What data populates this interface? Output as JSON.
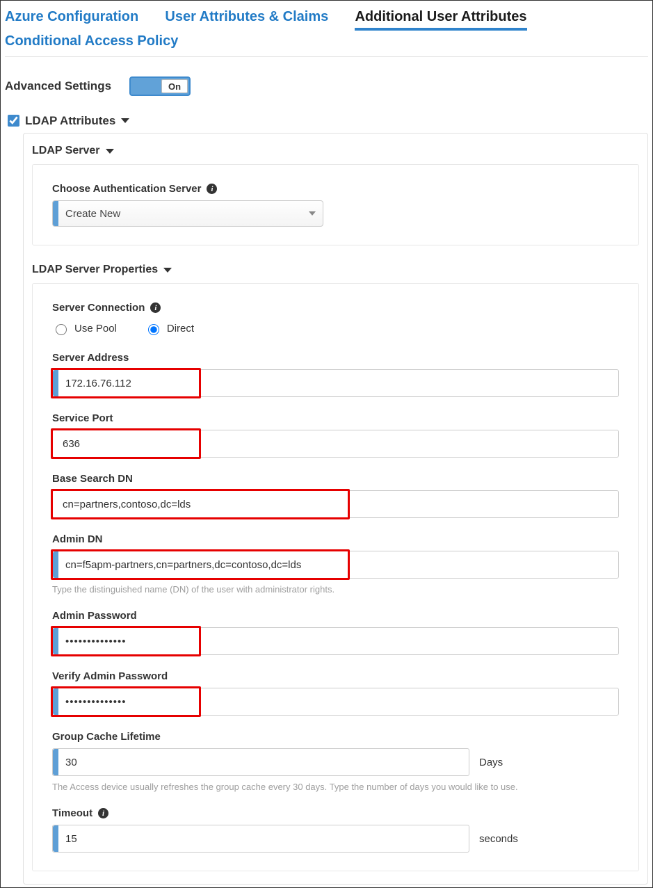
{
  "tabs": {
    "azure": "Azure Configuration",
    "claims": "User Attributes & Claims",
    "additional": "Additional User Attributes",
    "policy": "Conditional Access Policy"
  },
  "advanced": {
    "label": "Advanced Settings",
    "state": "On"
  },
  "ldap_attributes": {
    "title": "LDAP Attributes"
  },
  "ldap_server": {
    "title": "LDAP Server",
    "choose_label": "Choose Authentication Server",
    "choose_value": "Create New"
  },
  "ldap_props": {
    "title": "LDAP Server Properties",
    "server_connection_label": "Server Connection",
    "use_pool": "Use Pool",
    "direct": "Direct",
    "server_address_label": "Server Address",
    "server_address": "172.16.76.112",
    "service_port_label": "Service Port",
    "service_port": "636",
    "base_dn_label": "Base Search DN",
    "base_dn": "cn=partners,contoso,dc=lds",
    "admin_dn_label": "Admin DN",
    "admin_dn": "cn=f5apm-partners,cn=partners,dc=contoso,dc=lds",
    "admin_dn_help": "Type the distinguished name (DN) of the user with administrator rights.",
    "admin_pw_label": "Admin Password",
    "admin_pw": "••••••••••••••",
    "verify_pw_label": "Verify Admin Password",
    "verify_pw": "••••••••••••••",
    "group_cache_label": "Group Cache Lifetime",
    "group_cache": "30",
    "group_cache_suffix": "Days",
    "group_cache_help": "The Access device usually refreshes the group cache every 30 days. Type the number of days you would like to use.",
    "timeout_label": "Timeout",
    "timeout": "15",
    "timeout_suffix": "seconds"
  }
}
